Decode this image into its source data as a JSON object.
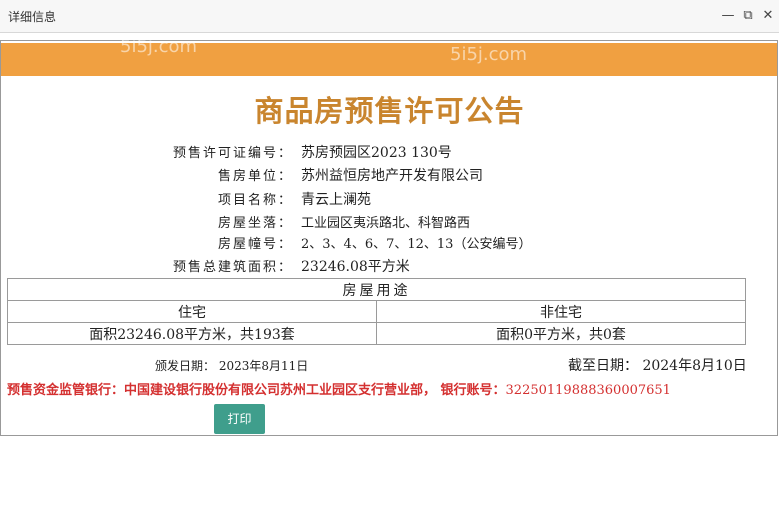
{
  "window": {
    "title": "详细信息",
    "minimize_glyph": "—",
    "restore_glyph": "⧉",
    "close_glyph": "✕"
  },
  "watermark": "5i5j.com",
  "heading": "商品房预售许可公告",
  "fields": [
    {
      "label": "预售许可证编号：",
      "value": "苏房预园区2023 130号"
    },
    {
      "label": "售房单位：",
      "value": "苏州益恒房地产开发有限公司"
    },
    {
      "label": "项目名称：",
      "value": "青云上澜苑"
    },
    {
      "label": "房屋坐落：",
      "value": "工业园区夷浜路北、科智路西"
    },
    {
      "label": "房屋幢号：",
      "value": "2、3、4、6、7、12、13（公安编号）"
    },
    {
      "label": "预售总建筑面积：",
      "value": "23246.08平方米"
    }
  ],
  "usage_table": {
    "title": "房屋用途",
    "headers": [
      "住宅",
      "非住宅"
    ],
    "values": [
      "面积23246.08平方米，共193套",
      "面积0平方米，共0套"
    ]
  },
  "issue_date": "颁发日期： 2023年8月11日",
  "until_date": "截至日期： 2024年8月10日",
  "bank": {
    "text": "预售资金监管银行：中国建设银行股份有限公司苏州工业园区支行营业部， 银行账号：",
    "account": "32250119888360007651"
  },
  "print_label": "打印"
}
